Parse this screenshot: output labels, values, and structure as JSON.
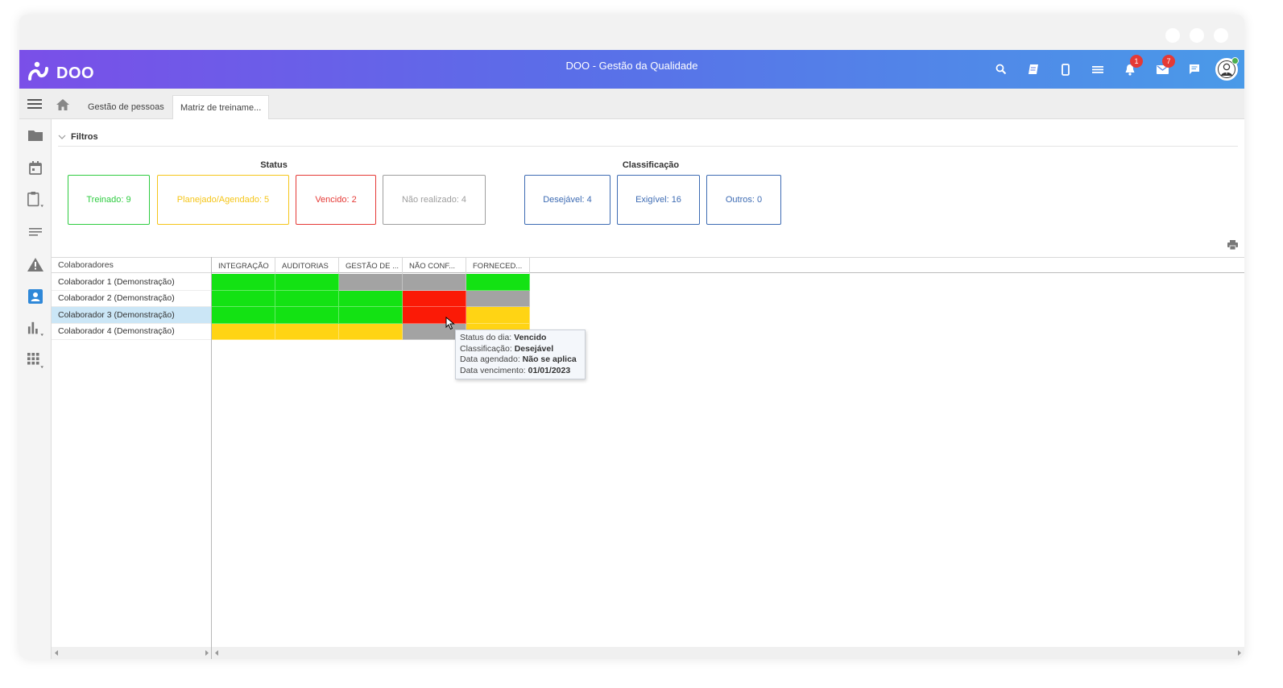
{
  "app": {
    "logo_text": "DOO",
    "title": "DOO - Gestão da Qualidade"
  },
  "topbar": {
    "icons": [
      "search-icon",
      "book-icon",
      "mobile-icon",
      "list-icon",
      "bell-icon",
      "mail-icon",
      "chat-icon"
    ],
    "notifications_count": "1",
    "messages_count": "7"
  },
  "tabs": [
    {
      "label": "Gestão de pessoas",
      "active": false
    },
    {
      "label": "Matriz de treiname...",
      "active": true
    }
  ],
  "sidebar": {
    "items": [
      "folder-icon",
      "calendar-icon",
      "clipboard-icon",
      "notes-icon",
      "warning-icon",
      "contact-card-icon",
      "bar-chart-icon",
      "apps-grid-icon"
    ]
  },
  "filters": {
    "label": "Filtros",
    "status_label": "Status",
    "classification_label": "Classificação",
    "status": [
      {
        "label": "Treinado: 9",
        "color": "#2ecc40"
      },
      {
        "label": "Planejado/Agendado: 5",
        "color": "#f5c518"
      },
      {
        "label": "Vencido: 2",
        "color": "#e53935"
      },
      {
        "label": "Não realizado: 4",
        "color": "#9e9e9e"
      }
    ],
    "classification": [
      {
        "label": "Desejável: 4",
        "color": "#3d6bb3"
      },
      {
        "label": "Exigível: 16",
        "color": "#3d6bb3"
      },
      {
        "label": "Outros: 0",
        "color": "#3d6bb3"
      }
    ]
  },
  "matrix": {
    "row_header": "Colaboradores",
    "columns": [
      "INTEGRAÇÃO",
      "AUDITORIAS",
      "GESTÃO DE ...",
      "NÃO CONF...",
      "FORNECED..."
    ],
    "rows": [
      {
        "name": "Colaborador 1 (Demonstração)",
        "cells": [
          "treinado",
          "treinado",
          "nao_realizado",
          "nao_realizado",
          "treinado"
        ]
      },
      {
        "name": "Colaborador 2 (Demonstração)",
        "cells": [
          "treinado",
          "treinado",
          "treinado",
          "vencido",
          "nao_realizado"
        ]
      },
      {
        "name": "Colaborador 3 (Demonstração)",
        "cells": [
          "treinado",
          "treinado",
          "treinado",
          "vencido",
          "planejado"
        ],
        "selected": true
      },
      {
        "name": "Colaborador 4 (Demonstração)",
        "cells": [
          "planejado",
          "planejado",
          "planejado",
          "nao_realizado",
          "planejado"
        ]
      }
    ],
    "cell_colors": {
      "treinado": "#13e213",
      "planejado": "#ffd414",
      "vencido": "#fb1a06",
      "nao_realizado": "#a3a3a3"
    }
  },
  "tooltip": {
    "status_label": "Status do dia:",
    "status_value": "Vencido",
    "class_label": "Classificação:",
    "class_value": "Desejável",
    "scheduled_label": "Data agendado:",
    "scheduled_value": "Não se aplica",
    "due_label": "Data vencimento:",
    "due_value": "01/01/2023"
  }
}
